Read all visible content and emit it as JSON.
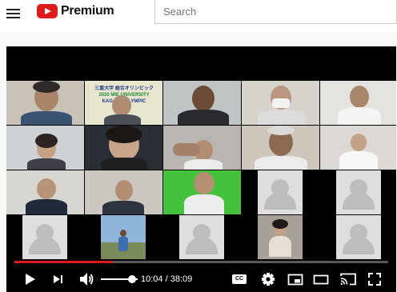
{
  "masthead": {
    "logo_text": "Premium",
    "search_placeholder": "Search"
  },
  "banner": {
    "line1": "三重大学 総合オリンピック",
    "line2": "2020 MIE UNIVERSITY",
    "line3": "KAGAKU OLYMPIC"
  },
  "player": {
    "time_current": "10:04",
    "time_separator": " / ",
    "time_total": "38:09",
    "progress": 0.264,
    "cc_label": "CC"
  },
  "colors": {
    "accent": "#e01b1b",
    "zoom_avatar_bg": "#dedede"
  },
  "icons": [
    "menu-icon",
    "youtube-logo-icon",
    "play-icon",
    "next-icon",
    "volume-icon",
    "subtitles-icon",
    "gear-icon",
    "miniplayer-icon",
    "theater-icon",
    "cast-icon",
    "fullscreen-icon"
  ]
}
